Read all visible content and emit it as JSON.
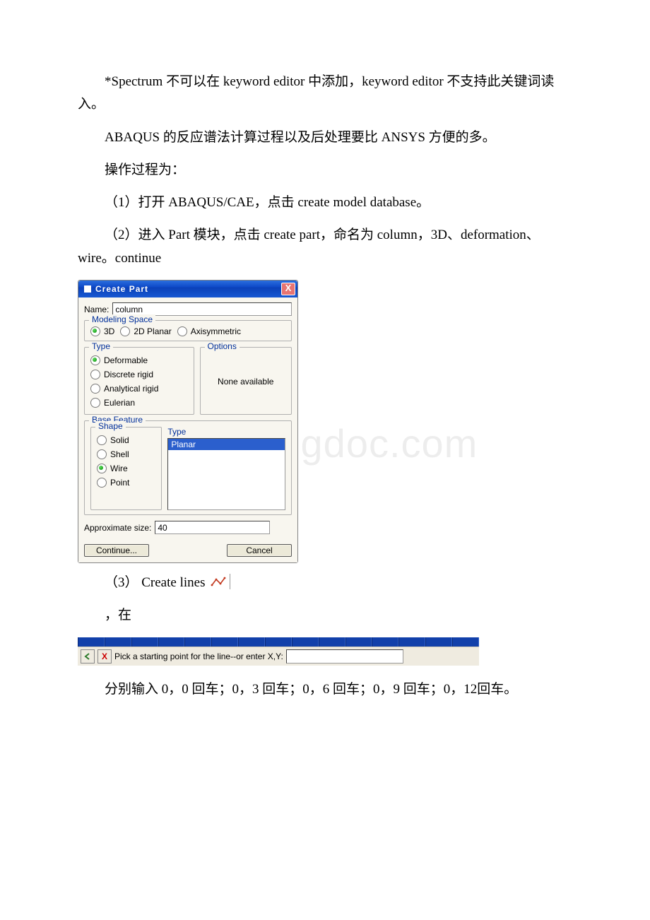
{
  "paragraphs": {
    "p1": "*Spectrum 不可以在 keyword editor 中添加，keyword editor 不支持此关键词读入。",
    "p2": "ABAQUS 的反应谱法计算过程以及后处理要比 ANSYS 方便的多。",
    "p3": "操作过程为：",
    "p4": "（1）打开 ABAQUS/CAE，点击 create model database。",
    "p5": "（2）进入 Part 模块，点击 create part，命名为 column，3D、deformation、wire。continue",
    "p6_prefix": "（3） Create lines ",
    "p7": "，在",
    "p8": "分别输入 0，0 回车；0，3 回车；0，6 回车；0，9 回车；0，12回车。"
  },
  "dialog": {
    "title": "Create Part",
    "name_label": "Name:",
    "name_value": "column",
    "modeling_space_legend": "Modeling Space",
    "ms_opts": {
      "a": "3D",
      "b": "2D Planar",
      "c": "Axisymmetric"
    },
    "type_legend": "Type",
    "type_opts": {
      "a": "Deformable",
      "b": "Discrete rigid",
      "c": "Analytical rigid",
      "d": "Eulerian"
    },
    "options_legend": "Options",
    "none_available": "None available",
    "base_feature_legend": "Base Feature",
    "shape_legend": "Shape",
    "shape_opts": {
      "a": "Solid",
      "b": "Shell",
      "c": "Wire",
      "d": "Point"
    },
    "feature_type_legend": "Type",
    "feature_type_selected": "Planar",
    "approx_size_label": "Approximate size:",
    "approx_size_value": "40",
    "continue_btn": "Continue...",
    "cancel_btn": "Cancel"
  },
  "prompt": {
    "text": "Pick a starting point for the line--or enter X,Y:"
  },
  "watermark": "www.bingdoc.com"
}
